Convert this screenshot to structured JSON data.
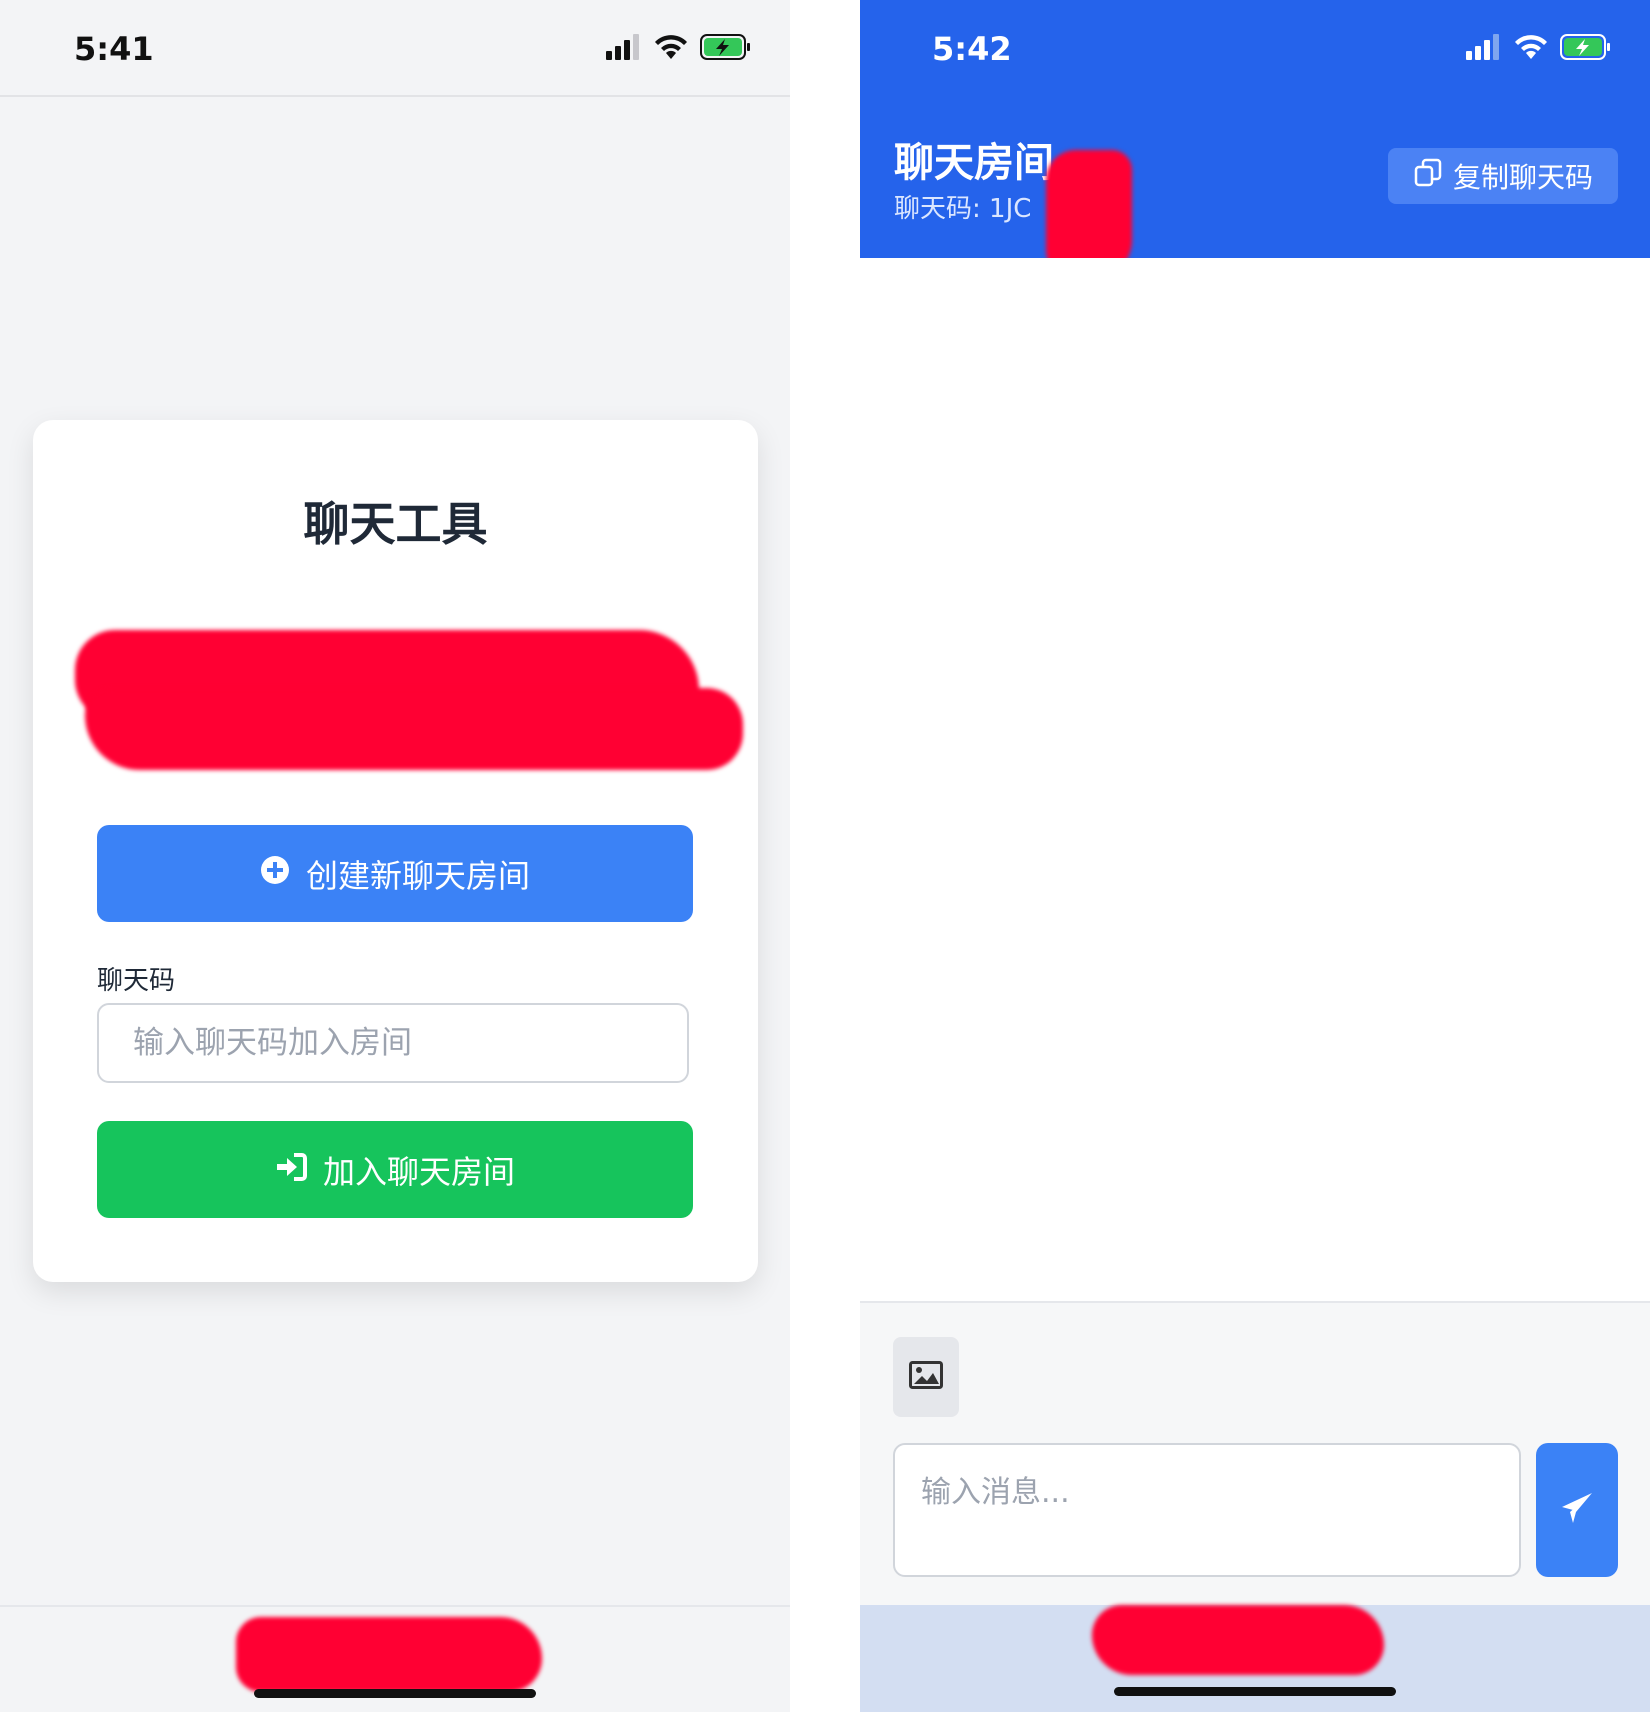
{
  "left_screen": {
    "status_time": "5:41",
    "card": {
      "title": "聊天工具",
      "create_button": "创建新聊天房间",
      "code_label": "聊天码",
      "code_placeholder": "输入聊天码加入房间",
      "join_button": "加入聊天房间"
    }
  },
  "right_screen": {
    "status_time": "5:42",
    "header": {
      "title": "聊天房间",
      "code_text": "聊天码: 1JC",
      "copy_button": "复制聊天码"
    },
    "composer": {
      "message_placeholder": "输入消息..."
    }
  },
  "colors": {
    "primary_blue": "#3b82f6",
    "header_blue": "#2563eb",
    "join_green": "#16c45c",
    "redaction_red": "#ff0033",
    "battery_green": "#34c759"
  },
  "icons": [
    "signal-icon",
    "wifi-icon",
    "battery-charging-icon",
    "plus-circle-icon",
    "sign-in-icon",
    "copy-icon",
    "image-icon",
    "send-icon"
  ]
}
